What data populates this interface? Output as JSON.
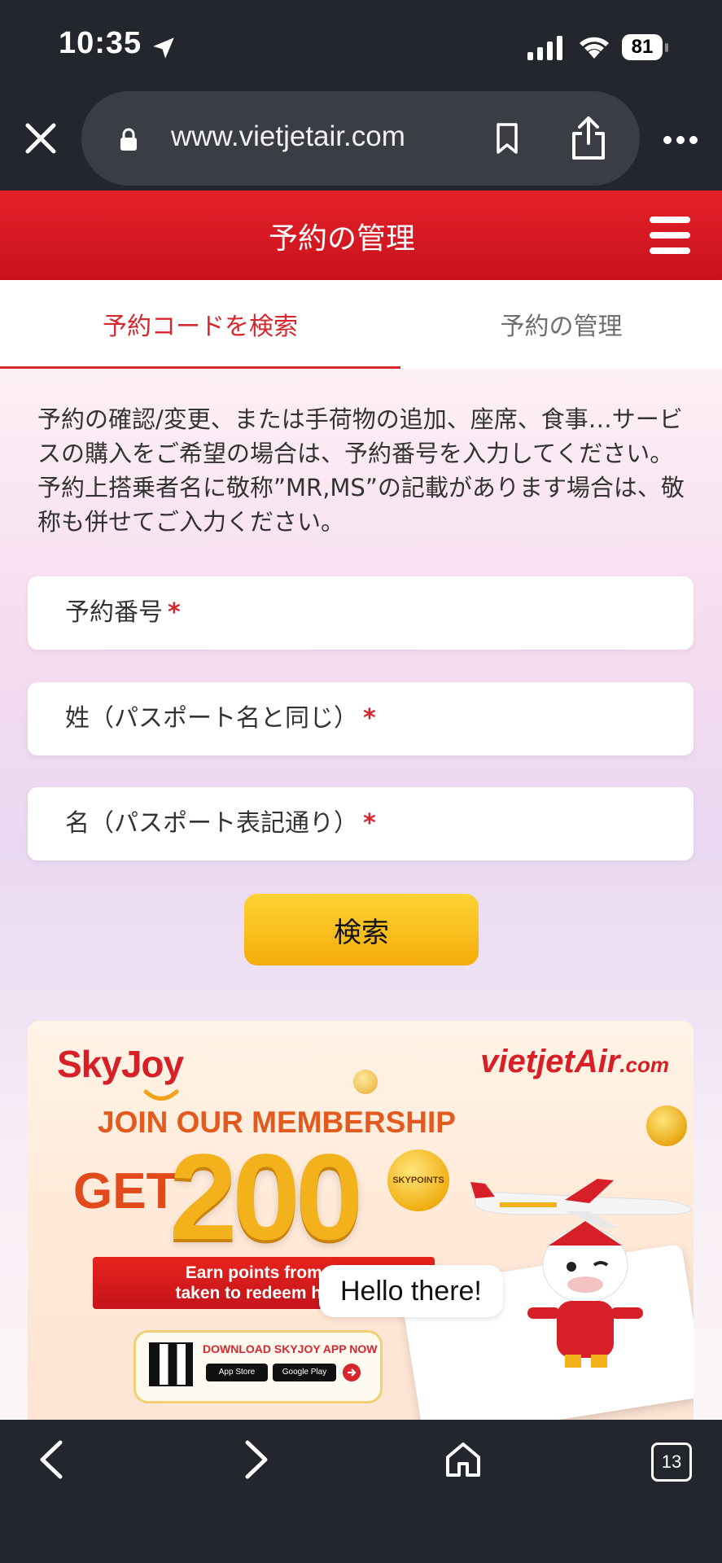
{
  "status_bar": {
    "time": "10:35",
    "battery": "81"
  },
  "browser": {
    "url": "www.vietjetair.com",
    "tab_count": "13"
  },
  "header": {
    "title": "予約の管理"
  },
  "tabs": [
    {
      "label": "予約コードを検索",
      "active": true
    },
    {
      "label": "予約の管理",
      "active": false
    }
  ],
  "intro_text": "予約の確認/変更、または手荷物の追加、座席、食事…サービスの購入をご希望の場合は、予約番号を入力してください。 予約上搭乗者名に敬称”MR,MS”の記載があります場合は、敬称も併せてご入力ください。",
  "form": {
    "booking_number": {
      "label": "予約番号",
      "required_mark": "*"
    },
    "last_name": {
      "label": "姓（パスポート名と同じ）",
      "required_mark": "*"
    },
    "first_name": {
      "label": "名（パスポート表記通り）",
      "required_mark": "*"
    },
    "search_button": "検索"
  },
  "banner": {
    "skyjoy_logo": "SkyJoy",
    "vietjet_logo": "vietjetAir",
    "vietjet_logo_suffix": ".com",
    "headline": "JOIN OUR MEMBERSHIP",
    "get": "GET",
    "points": "200",
    "points_unit": "SKYPOINTS",
    "earn_line1": "Earn points from fli",
    "earn_line2": "taken to redeem hot v",
    "download": "DOWNLOAD SKYJOY APP NOW",
    "app_store": "App Store",
    "google_play": "Google Play"
  },
  "chat_bubble": "Hello there!",
  "colors": {
    "brand_red": "#d6262e",
    "button_yellow": "#f8c21c",
    "chrome": "#23262d"
  }
}
